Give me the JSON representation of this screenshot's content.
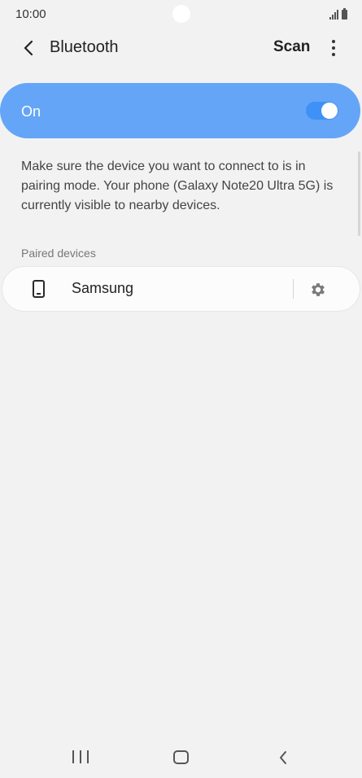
{
  "status_bar": {
    "time": "10:00",
    "icons": [
      "signal-icon",
      "battery-icon"
    ]
  },
  "header": {
    "title": "Bluetooth",
    "scan_label": "Scan",
    "back_icon": "chevron-left-icon",
    "more_icon": "more-vertical-icon"
  },
  "bluetooth_toggle": {
    "label": "On",
    "enabled": true,
    "accent_color": "#64a5f7",
    "switch_color": "#3e91f6"
  },
  "description": "Make sure the device you want to connect to is in pairing mode. Your phone (Galaxy Note20 Ultra 5G) is currently visible to nearby devices.",
  "paired_devices": {
    "section_title": "Paired devices",
    "items": [
      {
        "name": "Samsung",
        "icon": "smartphone-icon",
        "action_icon": "gear-icon"
      }
    ]
  },
  "nav_bar": {
    "buttons": [
      "recents-icon",
      "home-icon",
      "back-icon"
    ]
  }
}
